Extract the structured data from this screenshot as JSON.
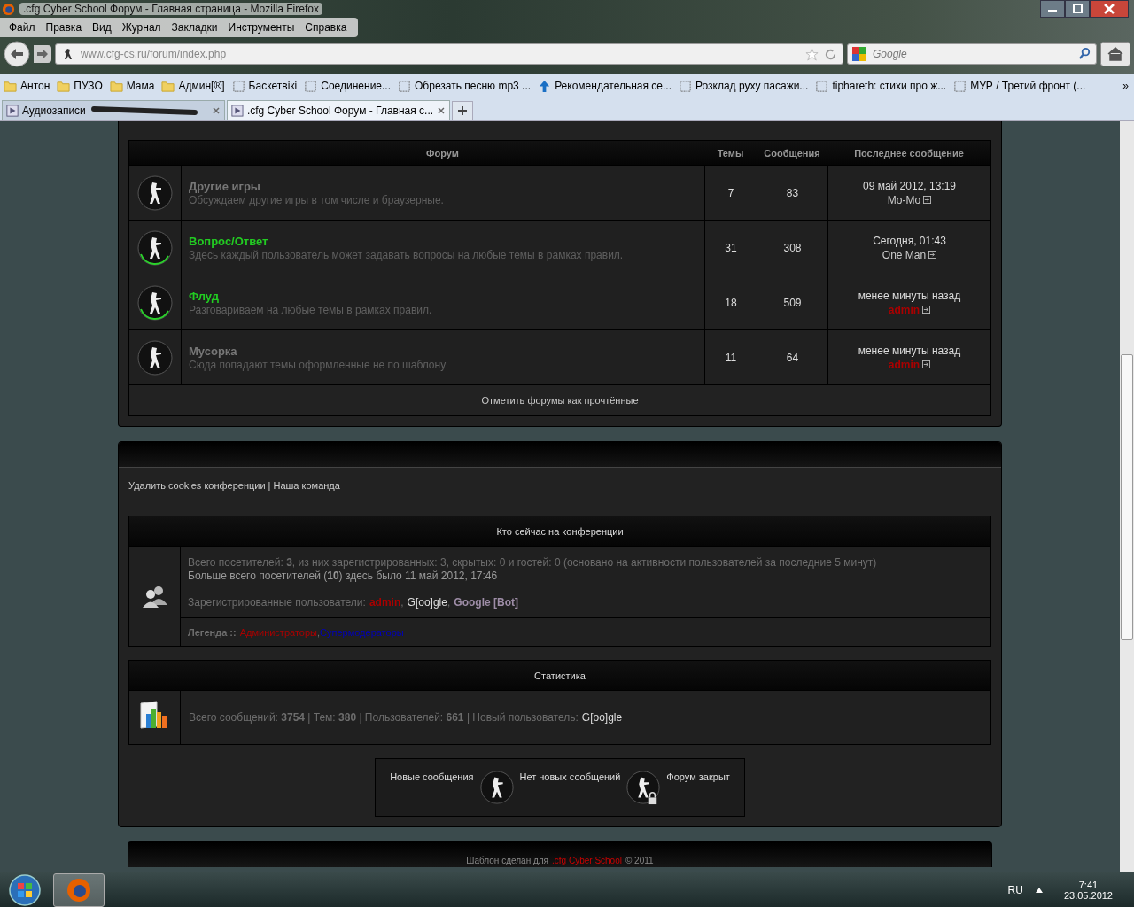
{
  "window": {
    "title": ".cfg Cyber School Форум - Главная страница - Mozilla Firefox"
  },
  "menu": [
    "Файл",
    "Правка",
    "Вид",
    "Журнал",
    "Закладки",
    "Инструменты",
    "Справка"
  ],
  "address_bar": {
    "value": "www.cfg-cs.ru/forum/index.php"
  },
  "search": {
    "placeholder": "Google"
  },
  "bookmarks": [
    {
      "label": "Антон",
      "kind": "folder"
    },
    {
      "label": "ПУЗО",
      "kind": "folder"
    },
    {
      "label": "Мама",
      "kind": "folder"
    },
    {
      "label": "Админ[®]",
      "kind": "folder"
    },
    {
      "label": "Баскетвікі",
      "kind": "page"
    },
    {
      "label": "Соединение...",
      "kind": "page"
    },
    {
      "label": "Обрезать песню mp3 ...",
      "kind": "page"
    },
    {
      "label": "Рекомендательная се...",
      "kind": "arrow"
    },
    {
      "label": "Розклад руху пасажи...",
      "kind": "page"
    },
    {
      "label": "tiphareth: стихи про ж...",
      "kind": "page"
    },
    {
      "label": "МУР / Третий фронт (...",
      "kind": "page"
    }
  ],
  "bookmarks_more": "»",
  "tabs": [
    {
      "label": "Аудиозаписи",
      "selected": false,
      "redacted": true
    },
    {
      "label": ".cfg Cyber School Форум - Главная с...",
      "selected": true,
      "redacted": false
    }
  ],
  "forum_table": {
    "columns": [
      "Форум",
      "Темы",
      "Сообщения",
      "Последнее сообщение"
    ],
    "rows": [
      {
        "title": "Другие игры",
        "description": "Обсуждаем другие игры в том числе и браузерные.",
        "unread": false,
        "topics": "7",
        "posts": "83",
        "last_time": "09 май 2012, 13:19",
        "last_author": "Mo-Mo",
        "last_author_admin": false
      },
      {
        "title": "Вопрос/Ответ",
        "description": "Здесь каждый пользователь может задавать вопросы на любые темы в рамках правил.",
        "unread": true,
        "topics": "31",
        "posts": "308",
        "last_time": "Сегодня, 01:43",
        "last_author": "One Man",
        "last_author_admin": false
      },
      {
        "title": "Флуд",
        "description": "Разговариваем на любые темы в рамках правил.",
        "unread": true,
        "topics": "18",
        "posts": "509",
        "last_time": "менее минуты назад",
        "last_author": "admin",
        "last_author_admin": true
      },
      {
        "title": "Мусорка",
        "description": "Сюда попадают темы оформленные не по шаблону",
        "unread": false,
        "topics": "11",
        "posts": "64",
        "last_time": "менее минуты назад",
        "last_author": "admin",
        "last_author_admin": true
      }
    ],
    "mark_read": "Отметить форумы как прочтённые"
  },
  "footer_links": [
    "Удалить cookies конференции",
    "Наша команда"
  ],
  "footer_links_separator": "|",
  "who_is_online": {
    "title": "Кто сейчас на конференции",
    "total": "Всего посетителей: **3**, из них зарегистрированных: 3, скрытых: 0 и гостей: 0 (основано на активности пользователей за последние 5 минут)",
    "record": "Больше всего посетителей (**10**) здесь было 11 май 2012, 17:46",
    "registered_label": "Зарегистрированные пользователи:",
    "separator": ",",
    "users": [
      {
        "name": "admin",
        "color": "#aa0000",
        "bold": true
      },
      {
        "name": "G[oo]gle",
        "color": "#dddddd",
        "bold": false
      },
      {
        "name": "Google [Bot]",
        "color": "#9e8da7",
        "bold": true
      }
    ],
    "legend_label": "Легенда ::",
    "legend": [
      {
        "name": "Администраторы",
        "color": "#aa0000"
      },
      {
        "name": "Супермодераторы",
        "color": "#0000bb"
      }
    ]
  },
  "statistics": {
    "title": "Статистика",
    "text": "Всего сообщений: **3754** | Тем: **380** | Пользователей: **661** | Новый пользователь:",
    "newest_user": "G[oo]gle"
  },
  "icon_legend": [
    {
      "label": "Новые сообщения",
      "kind": "new"
    },
    {
      "label": "Нет новых сообщений",
      "kind": "locked"
    },
    {
      "label": "Форум закрыт",
      "kind": "none"
    }
  ],
  "copyright": {
    "before": "Шаблон сделан для",
    "link": ".cfg Cyber School",
    "after": "© 2011"
  },
  "taskbar": {
    "language": "RU",
    "time": "7:41",
    "date": "23.05.2012"
  }
}
